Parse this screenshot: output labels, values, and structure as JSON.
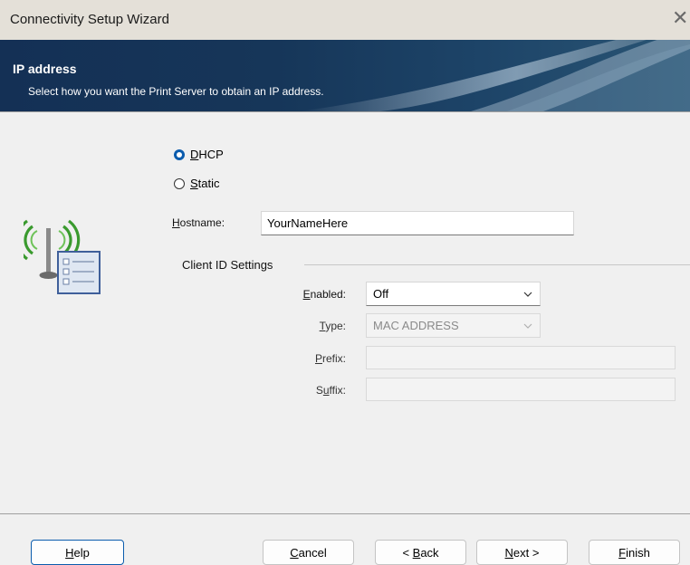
{
  "window": {
    "title": "Connectivity Setup Wizard",
    "close_glyph": "✕"
  },
  "header": {
    "title": "IP address",
    "subtitle": "Select how you want the Print Server to obtain an IP address."
  },
  "ip_mode": {
    "selected": "DHCP",
    "options": [
      {
        "label_mnemonic": "D",
        "label_rest": "HCP",
        "selected": true
      },
      {
        "label_mnemonic": "S",
        "label_rest": "tatic",
        "selected": false
      }
    ]
  },
  "hostname": {
    "label_mnemonic": "H",
    "label_rest": "ostname:",
    "value": "YourNameHere"
  },
  "client_id": {
    "group_title": "Client ID Settings",
    "enabled": {
      "label_mnemonic": "E",
      "label_rest": "nabled:",
      "value": "Off"
    },
    "type": {
      "label_mnemonic": "T",
      "label_rest": "ype:",
      "value": "MAC ADDRESS"
    },
    "prefix": {
      "label_mnemonic": "P",
      "label_rest": "refix:",
      "value": ""
    },
    "suffix": {
      "label_pre": "S",
      "label_mnemonic": "u",
      "label_rest": "ffix:",
      "value": ""
    }
  },
  "footer": {
    "help": {
      "mnemonic": "H",
      "rest": "elp"
    },
    "cancel": {
      "mnemonic": "C",
      "rest": "ancel"
    },
    "back": {
      "pre": "< ",
      "mnemonic": "B",
      "rest": "ack"
    },
    "next": {
      "mnemonic": "N",
      "rest": "ext >"
    },
    "finish": {
      "mnemonic": "F",
      "rest": "inish"
    }
  },
  "icons": {
    "wizard_graphic": "wireless-network-config-icon",
    "dropdown": "chevron-down-icon",
    "close": "close-icon"
  },
  "colors": {
    "accent": "#0b5cad",
    "banner": "#163659",
    "antenna_green": "#3a9a2e"
  }
}
